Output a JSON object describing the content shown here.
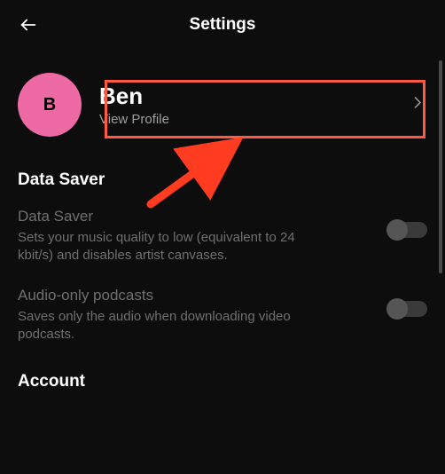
{
  "header": {
    "title": "Settings"
  },
  "profile": {
    "avatar_initial": "B",
    "name": "Ben",
    "subtitle": "View Profile"
  },
  "sections": {
    "data_saver": {
      "heading": "Data Saver",
      "items": [
        {
          "title": "Data Saver",
          "desc": "Sets your music quality to low (equivalent to 24 kbit/s) and disables artist canvases.",
          "enabled": false
        },
        {
          "title": "Audio-only podcasts",
          "desc": "Saves only the audio when downloading video podcasts.",
          "enabled": false
        }
      ]
    },
    "account": {
      "heading": "Account"
    }
  },
  "annotation": {
    "highlight_color": "#ff5a40"
  }
}
